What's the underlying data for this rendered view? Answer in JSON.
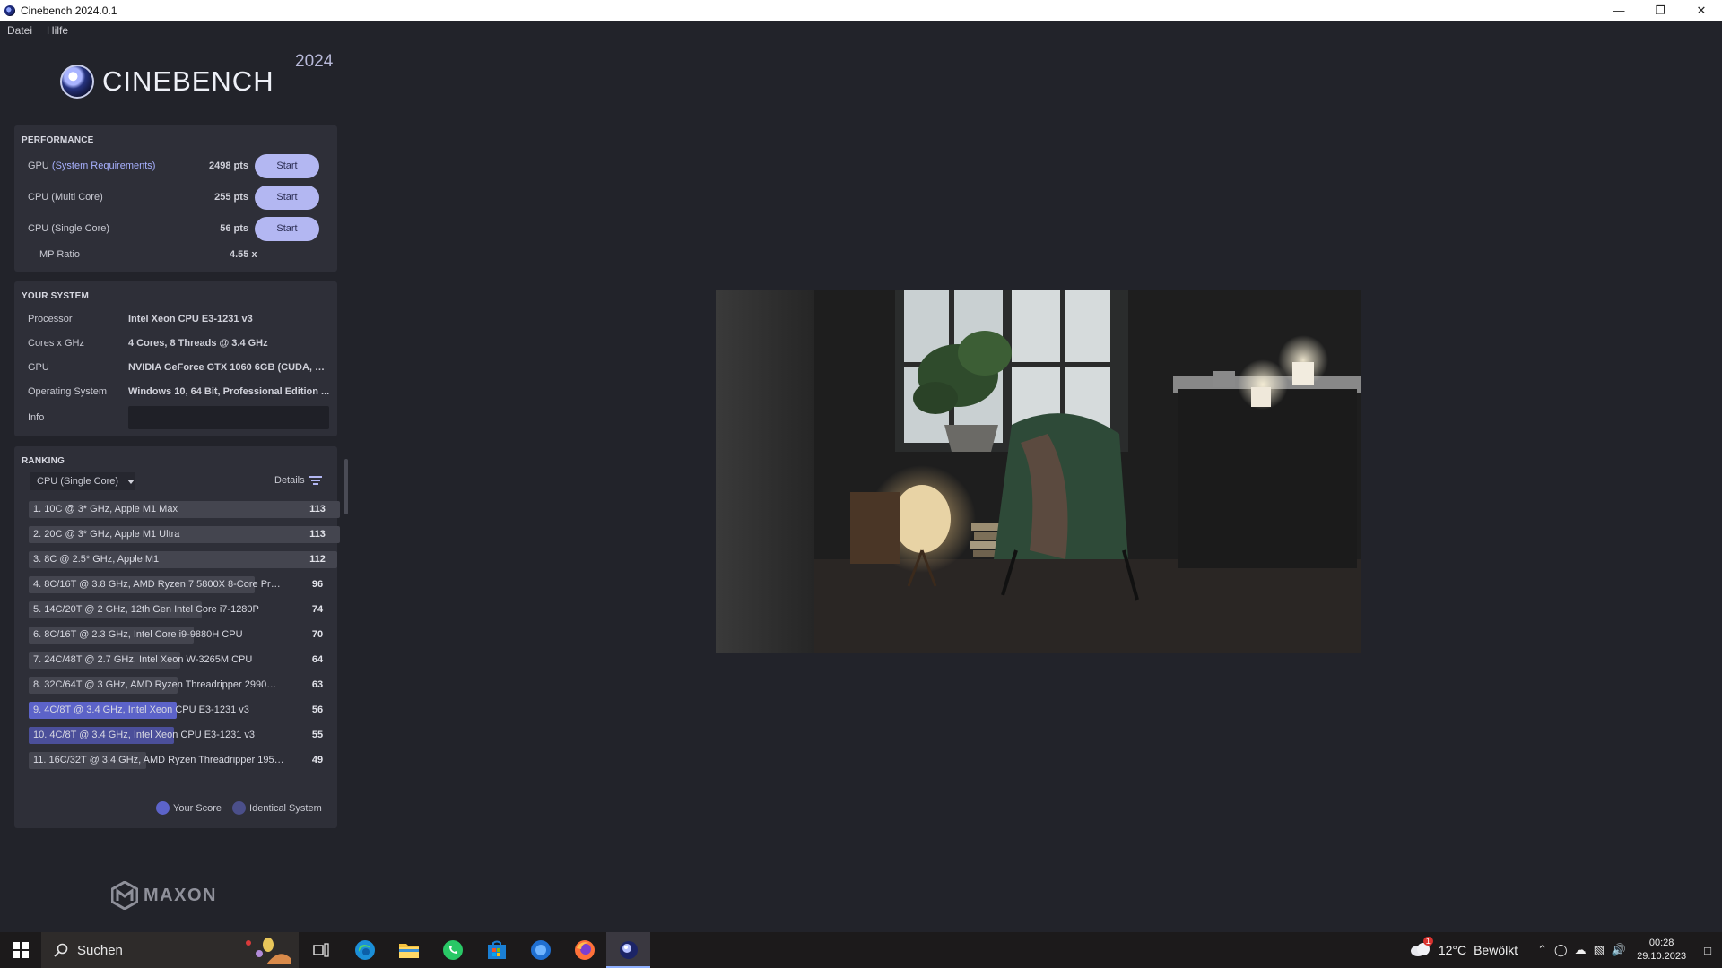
{
  "window": {
    "title": "Cinebench 2024.0.1"
  },
  "menu": {
    "items": [
      "Datei",
      "Hilfe"
    ]
  },
  "logo": {
    "word": "CINEBENCH",
    "year": "2024"
  },
  "performance": {
    "title": "PERFORMANCE",
    "rows": [
      {
        "label_main": "GPU ",
        "label_req": "(System Requirements)",
        "pts": "2498 pts",
        "button": "Start"
      },
      {
        "label_main": "CPU (Multi Core)",
        "label_req": "",
        "pts": "255 pts",
        "button": "Start"
      },
      {
        "label_main": "CPU (Single Core)",
        "label_req": "",
        "pts": "56 pts",
        "button": "Start"
      }
    ],
    "mp_ratio": {
      "label": "MP Ratio",
      "value": "4.55 x"
    }
  },
  "system": {
    "title": "YOUR SYSTEM",
    "rows": [
      {
        "label": "Processor",
        "value": "Intel Xeon CPU E3-1231 v3"
      },
      {
        "label": "Cores x GHz",
        "value": "4 Cores, 8 Threads @ 3.4 GHz"
      },
      {
        "label": "GPU",
        "value": "NVIDIA GeForce GTX 1060 6GB (CUDA, D..."
      },
      {
        "label": "Operating System",
        "value": "Windows 10, 64 Bit, Professional Edition ..."
      }
    ],
    "info_label": "Info",
    "info_value": ""
  },
  "ranking": {
    "title": "RANKING",
    "selected": "CPU (Single Core)",
    "details_label": "Details",
    "items": [
      {
        "name": "1. 10C @ 3* GHz, Apple M1 Max",
        "score": "113",
        "fill": 1.0,
        "kind": "other"
      },
      {
        "name": "2. 20C @ 3* GHz, Apple M1 Ultra",
        "score": "113",
        "fill": 1.0,
        "kind": "other"
      },
      {
        "name": "3. 8C @ 2.5* GHz, Apple M1",
        "score": "112",
        "fill": 0.99,
        "kind": "other"
      },
      {
        "name": "4. 8C/16T @ 3.8 GHz, AMD Ryzen 7 5800X 8-Core Proces...",
        "score": "96",
        "fill": 0.85,
        "kind": "other"
      },
      {
        "name": "5. 14C/20T @ 2 GHz, 12th Gen Intel Core i7-1280P",
        "score": "74",
        "fill": 0.65,
        "kind": "other"
      },
      {
        "name": "6. 8C/16T @ 2.3 GHz, Intel Core i9-9880H CPU",
        "score": "70",
        "fill": 0.62,
        "kind": "other"
      },
      {
        "name": "7. 24C/48T @ 2.7 GHz, Intel Xeon W-3265M CPU",
        "score": "64",
        "fill": 0.57,
        "kind": "other"
      },
      {
        "name": "8. 32C/64T @ 3 GHz, AMD Ryzen Threadripper 2990WX 3...",
        "score": "63",
        "fill": 0.56,
        "kind": "other"
      },
      {
        "name": "9. 4C/8T @ 3.4 GHz, Intel Xeon CPU E3-1231 v3",
        "score": "56",
        "fill": 0.5,
        "kind": "mine"
      },
      {
        "name": "10. 4C/8T @ 3.4 GHz, Intel Xeon CPU E3-1231 v3",
        "score": "55",
        "fill": 0.49,
        "kind": "ident"
      },
      {
        "name": "11. 16C/32T @ 3.4 GHz, AMD Ryzen Threadripper 1950X ...",
        "score": "49",
        "fill": 0.44,
        "kind": "other"
      }
    ],
    "legend": {
      "your_score": "Your Score",
      "identical": "Identical System"
    }
  },
  "brand": {
    "maxon": "MAXON"
  },
  "taskbar": {
    "search_placeholder": "Suchen",
    "weather": {
      "temp": "12°C",
      "desc": "Bewölkt",
      "badge": "1"
    },
    "clock": {
      "time": "00:28",
      "date": "29.10.2023"
    },
    "apps": [
      "task-view-icon",
      "edge-icon",
      "file-explorer-icon",
      "whatsapp-icon",
      "store-icon",
      "app-icon",
      "firefox-icon",
      "cinebench-icon"
    ]
  },
  "colors": {
    "accent": "#b3b7f2",
    "your_score": "#5c63c9",
    "identical": "#4b4f9a",
    "panel": "#2e2f38",
    "background": "#22232a"
  }
}
